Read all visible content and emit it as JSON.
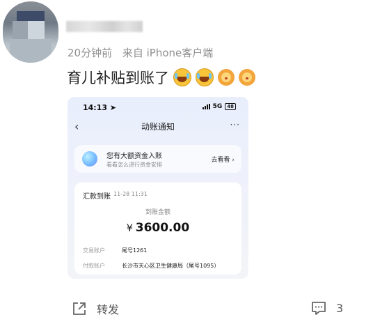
{
  "post": {
    "meta_time": "20分钟前",
    "meta_source": "来自 iPhone客户端",
    "text": "育儿补贴到账了",
    "emojis": [
      "laugh-cry-emoji",
      "laugh-cry-emoji",
      "lion-emoji",
      "lion-emoji"
    ]
  },
  "screenshot": {
    "status_time": "14:13",
    "network": "5G",
    "battery": "48",
    "nav_title": "动账通知",
    "nav_more": "···",
    "banner": {
      "title": "您有大额资金入账",
      "subtitle": "看看怎么进行资金安排",
      "action": "去看看"
    },
    "card": {
      "title": "汇款到账",
      "time": "11-28 11:31",
      "amount_label": "到账金额",
      "currency": "¥",
      "amount": "3600.00",
      "rows": [
        {
          "key": "交易账户",
          "value": "尾号1261"
        },
        {
          "key": "付款账户",
          "value": "长沙市天心区卫生健康局（尾号1095）"
        }
      ]
    }
  },
  "footer": {
    "repost_label": "转发",
    "comment_count": "3"
  },
  "colors": {
    "meta_gray": "#8f8f8f",
    "text": "#222222",
    "screenshot_bg": "#e8eefc"
  }
}
